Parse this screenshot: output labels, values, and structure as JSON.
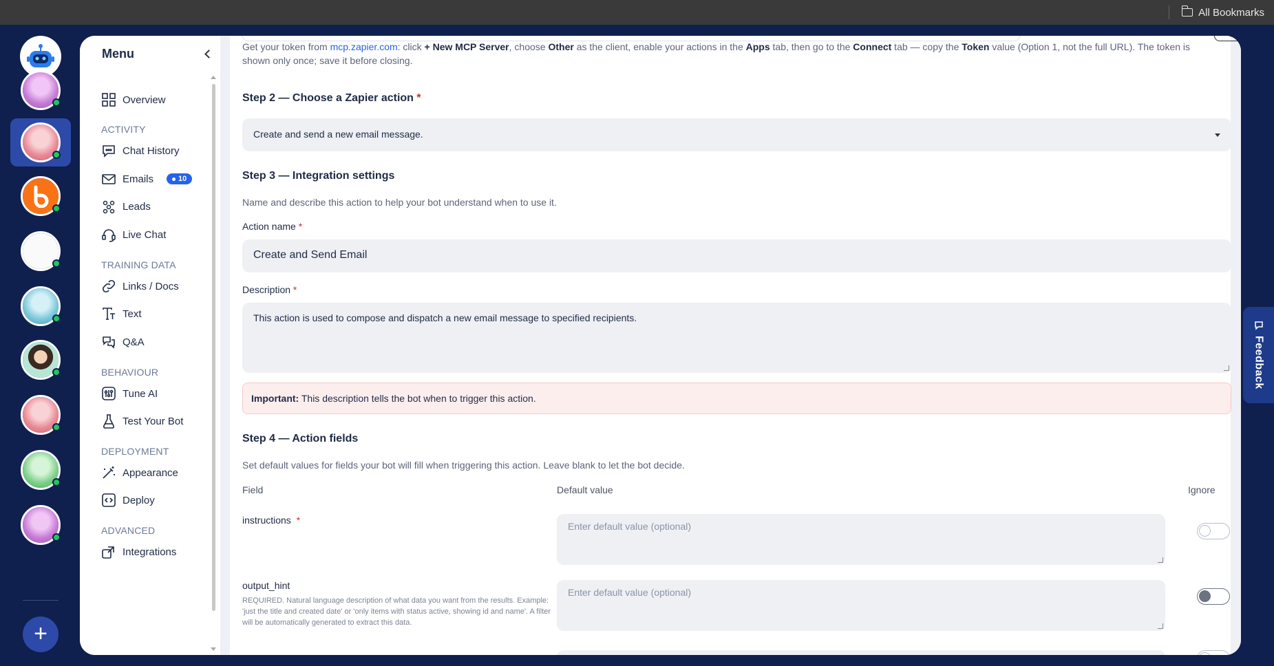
{
  "browser": {
    "bookmarks_label": "All Bookmarks"
  },
  "menu": {
    "title": "Menu",
    "items": [
      {
        "label": "Overview",
        "icon": "grid-icon"
      },
      {
        "label": "Chat History",
        "icon": "chat-icon"
      },
      {
        "label": "Emails",
        "icon": "mail-icon",
        "badge": "10"
      },
      {
        "label": "Leads",
        "icon": "leads-icon"
      },
      {
        "label": "Live Chat",
        "icon": "headset-icon"
      },
      {
        "label": "Links / Docs",
        "icon": "link-icon"
      },
      {
        "label": "Text",
        "icon": "text-icon"
      },
      {
        "label": "Q&A",
        "icon": "qa-icon"
      },
      {
        "label": "Tune AI",
        "icon": "tune-icon"
      },
      {
        "label": "Test Your Bot",
        "icon": "flask-icon"
      },
      {
        "label": "Appearance",
        "icon": "wand-icon"
      },
      {
        "label": "Deploy",
        "icon": "deploy-icon"
      },
      {
        "label": "Integrations",
        "icon": "integrations-icon"
      }
    ],
    "sections": [
      "ACTIVITY",
      "TRAINING DATA",
      "BEHAVIOUR",
      "DEPLOYMENT",
      "ADVANCED"
    ]
  },
  "content": {
    "token_help": {
      "prefix": "Get your token from ",
      "link": "mcp.zapier.com",
      "t1": ": click ",
      "b1": "+ New MCP Server",
      "t2": ", choose ",
      "b2": "Other",
      "t3": " as the client, enable your actions in the ",
      "b3": "Apps",
      "t4": " tab, then go to the ",
      "b4": "Connect",
      "t5": " tab — copy the ",
      "b5": "Token",
      "t6": " value (Option 1, not the full URL). The token is",
      "line2": "shown only once; save it before closing."
    },
    "step2": {
      "title": "Step 2 — Choose a Zapier action",
      "required": "*",
      "selected": "Create and send a new email message."
    },
    "step3": {
      "title": "Step 3 — Integration settings",
      "subtitle": "Name and describe this action to help your bot understand when to use it.",
      "action_name_label": "Action name",
      "action_name_value": "Create and Send Email",
      "description_label": "Description",
      "description_value": "This action is used to compose and dispatch a new email message to specified recipients.",
      "notice_bold": "Important:",
      "notice_text": " This description tells the bot when to trigger this action."
    },
    "step4": {
      "title": "Step 4 — Action fields",
      "subtitle": "Set default values for fields your bot will fill when triggering this action. Leave blank to let the bot decide.",
      "col_field": "Field",
      "col_default": "Default value",
      "col_ignore": "Ignore",
      "placeholder": "Enter default value (optional)",
      "fields": [
        {
          "name": "instructions",
          "required": "*",
          "help": ""
        },
        {
          "name": "output_hint",
          "required": "",
          "help": "REQUIRED. Natural language description of what data you want from the results. Example: 'just the title and created date' or 'only items with status active, showing id and name'. A filter will be automatically generated to extract this data."
        }
      ]
    }
  },
  "feedback": {
    "label": "Feedback"
  },
  "colors": {
    "rail": "#0f1f4e",
    "accent": "#2563eb",
    "active_rail": "#2d4aa8",
    "online": "#22c55e"
  }
}
